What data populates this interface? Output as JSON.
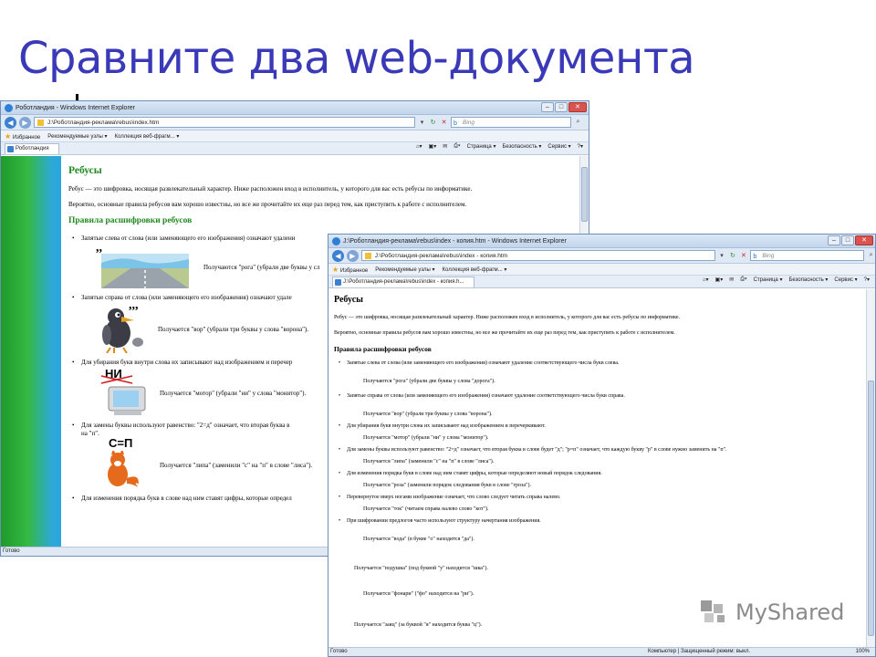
{
  "slide": {
    "title": "Сравните два web-документа"
  },
  "win1": {
    "window_title": "Роботландия - Windows Internet Explorer",
    "address": "J:\\Роботландия-реклама\\rebus\\index.htm",
    "search_placeholder": "Bing",
    "fav_label": "Избранное",
    "fav_items": [
      "Рекомендуемые узлы ▾",
      "Коллекция веб-фрагм... ▾"
    ],
    "tab_label": "Роботландия",
    "commands": [
      "Страница ▾",
      "Безопасность ▾",
      "Сервис ▾"
    ],
    "status": "Готово",
    "content": {
      "h1": "Ребусы",
      "p1": "Ребус — это шифровка, носящая развлекательный характер. Ниже расположен вход в исполнитель, у которого для вас есть ребусы по информатике.",
      "p2": "Вероятно, основные правила ребусов вам хорошо известны, но все же прочитайте их еще раз перед тем, как приступить к работе с исполнителем.",
      "h2": "Правила расшифровки ребусов",
      "rule1": "Запятые слева от слова (или заменяющего его изображения) означают удалени",
      "cap1": "Получаются \"рога\" (убрали две буквы у сл",
      "rule2": "Запятые справа от слова (или заменяющего его изображения) означают удале",
      "cap2": "Получается \"вор\" (убрали три буквы у слова \"ворона\").",
      "rule3": "Для убирания букв внутри слова их записывают над изображением и перечер",
      "strike_text": "НИ",
      "cap3": "Получается \"мотор\" (убрали \"ни\" у слова \"монитор\").",
      "rule4": "Для замены буквы используют равенство: \"2=д\" означает, что вторая буква в",
      "rule4b": "на \"п\".",
      "eq_text": "С=П",
      "cap4": "Получается \"липа\" (заменили \"с\" на \"п\" в слове \"лиса\").",
      "rule5": "Для изменения порядка букв в слове над ним ставят цифры, которые определ",
      "commas_left": ",,",
      "commas_right": ",,,"
    }
  },
  "win2": {
    "window_title": "J:\\Роботландия-реклама\\rebus\\index - копия.htm - Windows Internet Explorer",
    "address": "J:\\Роботландия-реклама\\rebus\\index - копия.htm",
    "search_placeholder": "Bing",
    "fav_label": "Избранное",
    "fav_items": [
      "Рекомендуемые узлы ▾",
      "Коллекция веб-фрагм... ▾"
    ],
    "tab_label": "J:\\Роботландия-реклама\\rebus\\index - копия.h...",
    "commands": [
      "Страница ▾",
      "Безопасность ▾",
      "Сервис ▾"
    ],
    "status": "Готово",
    "status_right": "Компьютер | Защищенный режим: выкл.",
    "zoom": "100%",
    "content": {
      "h1": "Ребусы",
      "p1": "Ребус — это шифровка, носящая развлекательный характер. Ниже расположен вход в исполнитель, у которого для вас есть ребусы по информатике.",
      "p2": "Вероятно, основные правила ребусов вам хорошо известны, но все же прочитайте их еще раз перед тем, как приступить к работе с исполнителем.",
      "h2": "Правила расшифровки ребусов",
      "lines": [
        {
          "t": "Запятые слева от слова (или заменяющего его изображения) означают удаление соответствующего числа букв слева.",
          "k": "b",
          "gap": 8
        },
        {
          "t": "Получаются \"рога\" (убрали две буквы у слова \"дорога\").",
          "k": "c",
          "gap": 4
        },
        {
          "t": "Запятые справа от слова (или заменяющего его изображения) означают удаление соответствующего числа букв справа.",
          "k": "b",
          "gap": 8
        },
        {
          "t": "Получается \"вор\" (убрали три буквы у слова \"ворона\").",
          "k": "c",
          "gap": 1
        },
        {
          "t": "Для убирания букв внутри слова их записывают над изображением и перечеркивают.",
          "k": "b",
          "gap": 1
        },
        {
          "t": "Получается \"мотор\" (убрали \"ни\" у слова \"монитор\").",
          "k": "c",
          "gap": 1
        },
        {
          "t": "Для замены буквы используют равенство: \"2=д\" означает, что вторая буква в слове будет \"д\"; \"р=п\" означает, что каждую букву \"р\" в слове нужно заменить на \"п\".",
          "k": "b",
          "gap": 1
        },
        {
          "t": "Получается \"липа\" (заменили \"с\" на \"п\" в слове \"лиса\").",
          "k": "c",
          "gap": 1
        },
        {
          "t": "Для изменения порядка букв в слове над ним ставят цифры, которые определяют новый порядок следования.",
          "k": "b",
          "gap": 1
        },
        {
          "t": "Получается \"роза\" (заменили порядок следования букв в слове \"гроза\").",
          "k": "c",
          "gap": 1
        },
        {
          "t": "Перевернутое вверх ногами изображение означает, что слово следует читать справа налево.",
          "k": "b",
          "gap": 1
        },
        {
          "t": "Получается \"ток\" (читаем справа налево слово \"кот\").",
          "k": "c",
          "gap": 1
        },
        {
          "t": "При шифровании предлогов часто используют структуру начертания изображения.",
          "k": "b",
          "gap": 8
        },
        {
          "t": "Получается \"вода\" (в букве \"о\" находится \"да\").",
          "k": "c",
          "gap": 20
        },
        {
          "t": "Получается \"подушка\" (под буквой \"у\" находится \"шка\").",
          "k": "c2",
          "gap": 16
        },
        {
          "t": "Получается \"фонари\" (\"фо\" находится на \"ри\").",
          "k": "c",
          "gap": 22
        },
        {
          "t": "Получается \"заяц\" (за буквой \"я\" находится буква \"ц\").",
          "k": "c2",
          "gap": 20
        },
        {
          "t": "Получается \"наука\" (на букве \"у\" находится \"ка\").",
          "k": "c",
          "gap": 0
        }
      ]
    }
  },
  "watermark": {
    "text": "MyShared"
  }
}
